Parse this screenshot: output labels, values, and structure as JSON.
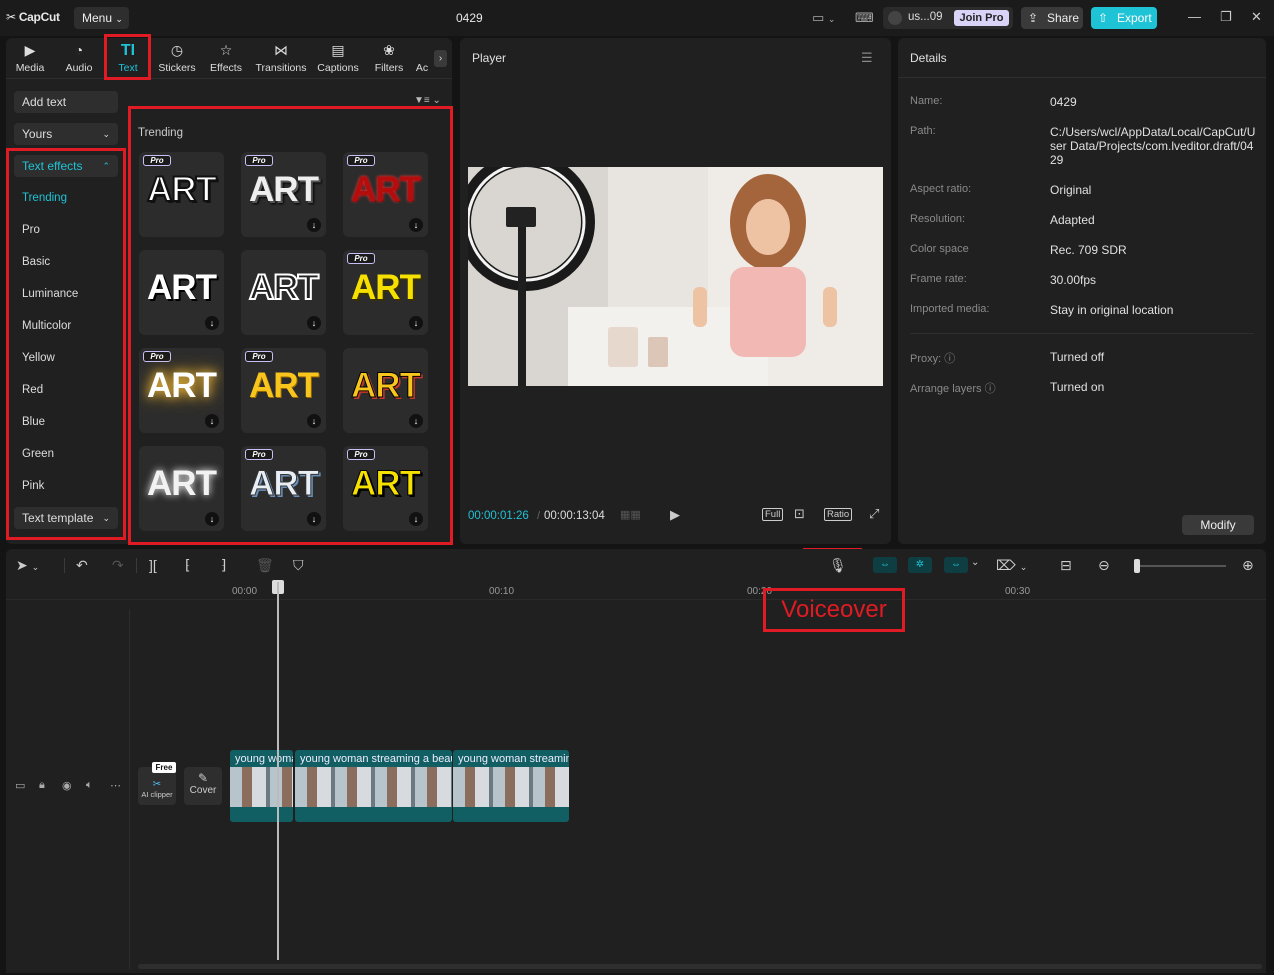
{
  "app": {
    "logo": "CapCut",
    "menu_label": "Menu",
    "project_title": "0429"
  },
  "account": {
    "user": "us...09",
    "join_pro": "Join Pro",
    "share": "Share",
    "export": "Export"
  },
  "tabs": [
    {
      "label": "Media",
      "icon": "media-icon"
    },
    {
      "label": "Audio",
      "icon": "audio-icon"
    },
    {
      "label": "Text",
      "icon": "text-icon"
    },
    {
      "label": "Stickers",
      "icon": "sticker-icon"
    },
    {
      "label": "Effects",
      "icon": "effects-icon"
    },
    {
      "label": "Transitions",
      "icon": "transitions-icon"
    },
    {
      "label": "Captions",
      "icon": "captions-icon"
    },
    {
      "label": "Filters",
      "icon": "filters-icon"
    },
    {
      "label": "Ac",
      "icon": "adjust-icon"
    }
  ],
  "sidebar": {
    "add_text": "Add text",
    "yours": "Yours",
    "text_effects": "Text effects",
    "items": [
      "Trending",
      "Pro",
      "Basic",
      "Luminance",
      "Multicolor",
      "Yellow",
      "Red",
      "Blue",
      "Green",
      "Pink"
    ],
    "text_template": "Text template"
  },
  "grid": {
    "section_label": "Trending",
    "card_text": "ART",
    "pro_label": "Pro"
  },
  "player": {
    "title": "Player",
    "current_time": "00:00:01:26",
    "total_time": "00:00:13:04",
    "full_label": "Full",
    "ratio_label": "Ratio"
  },
  "details": {
    "title": "Details",
    "rows": [
      {
        "key": "Name:",
        "value": "0429"
      },
      {
        "key": "Path:",
        "value": "C:/Users/wcl/AppData/Local/CapCut/User Data/Projects/com.lveditor.draft/0429"
      },
      {
        "key": "Aspect ratio:",
        "value": "Original"
      },
      {
        "key": "Resolution:",
        "value": "Adapted"
      },
      {
        "key": "Color space",
        "value": "Rec. 709 SDR"
      },
      {
        "key": "Frame rate:",
        "value": "30.00fps"
      },
      {
        "key": "Imported media:",
        "value": "Stay in original location"
      },
      {
        "key": "Proxy:",
        "value": "Turned off"
      },
      {
        "key": "Arrange layers",
        "value": "Turned on"
      }
    ],
    "modify": "Modify"
  },
  "timeline": {
    "ruler": [
      "00:00",
      "00:10",
      "00:20",
      "00:30"
    ],
    "clips": [
      "young woma",
      "young woman streaming a beau",
      "young woman streaming"
    ],
    "ai_clipper": "AI clipper",
    "free_badge": "Free",
    "cover": "Cover"
  },
  "annotation": {
    "voiceover": "Voiceover"
  }
}
